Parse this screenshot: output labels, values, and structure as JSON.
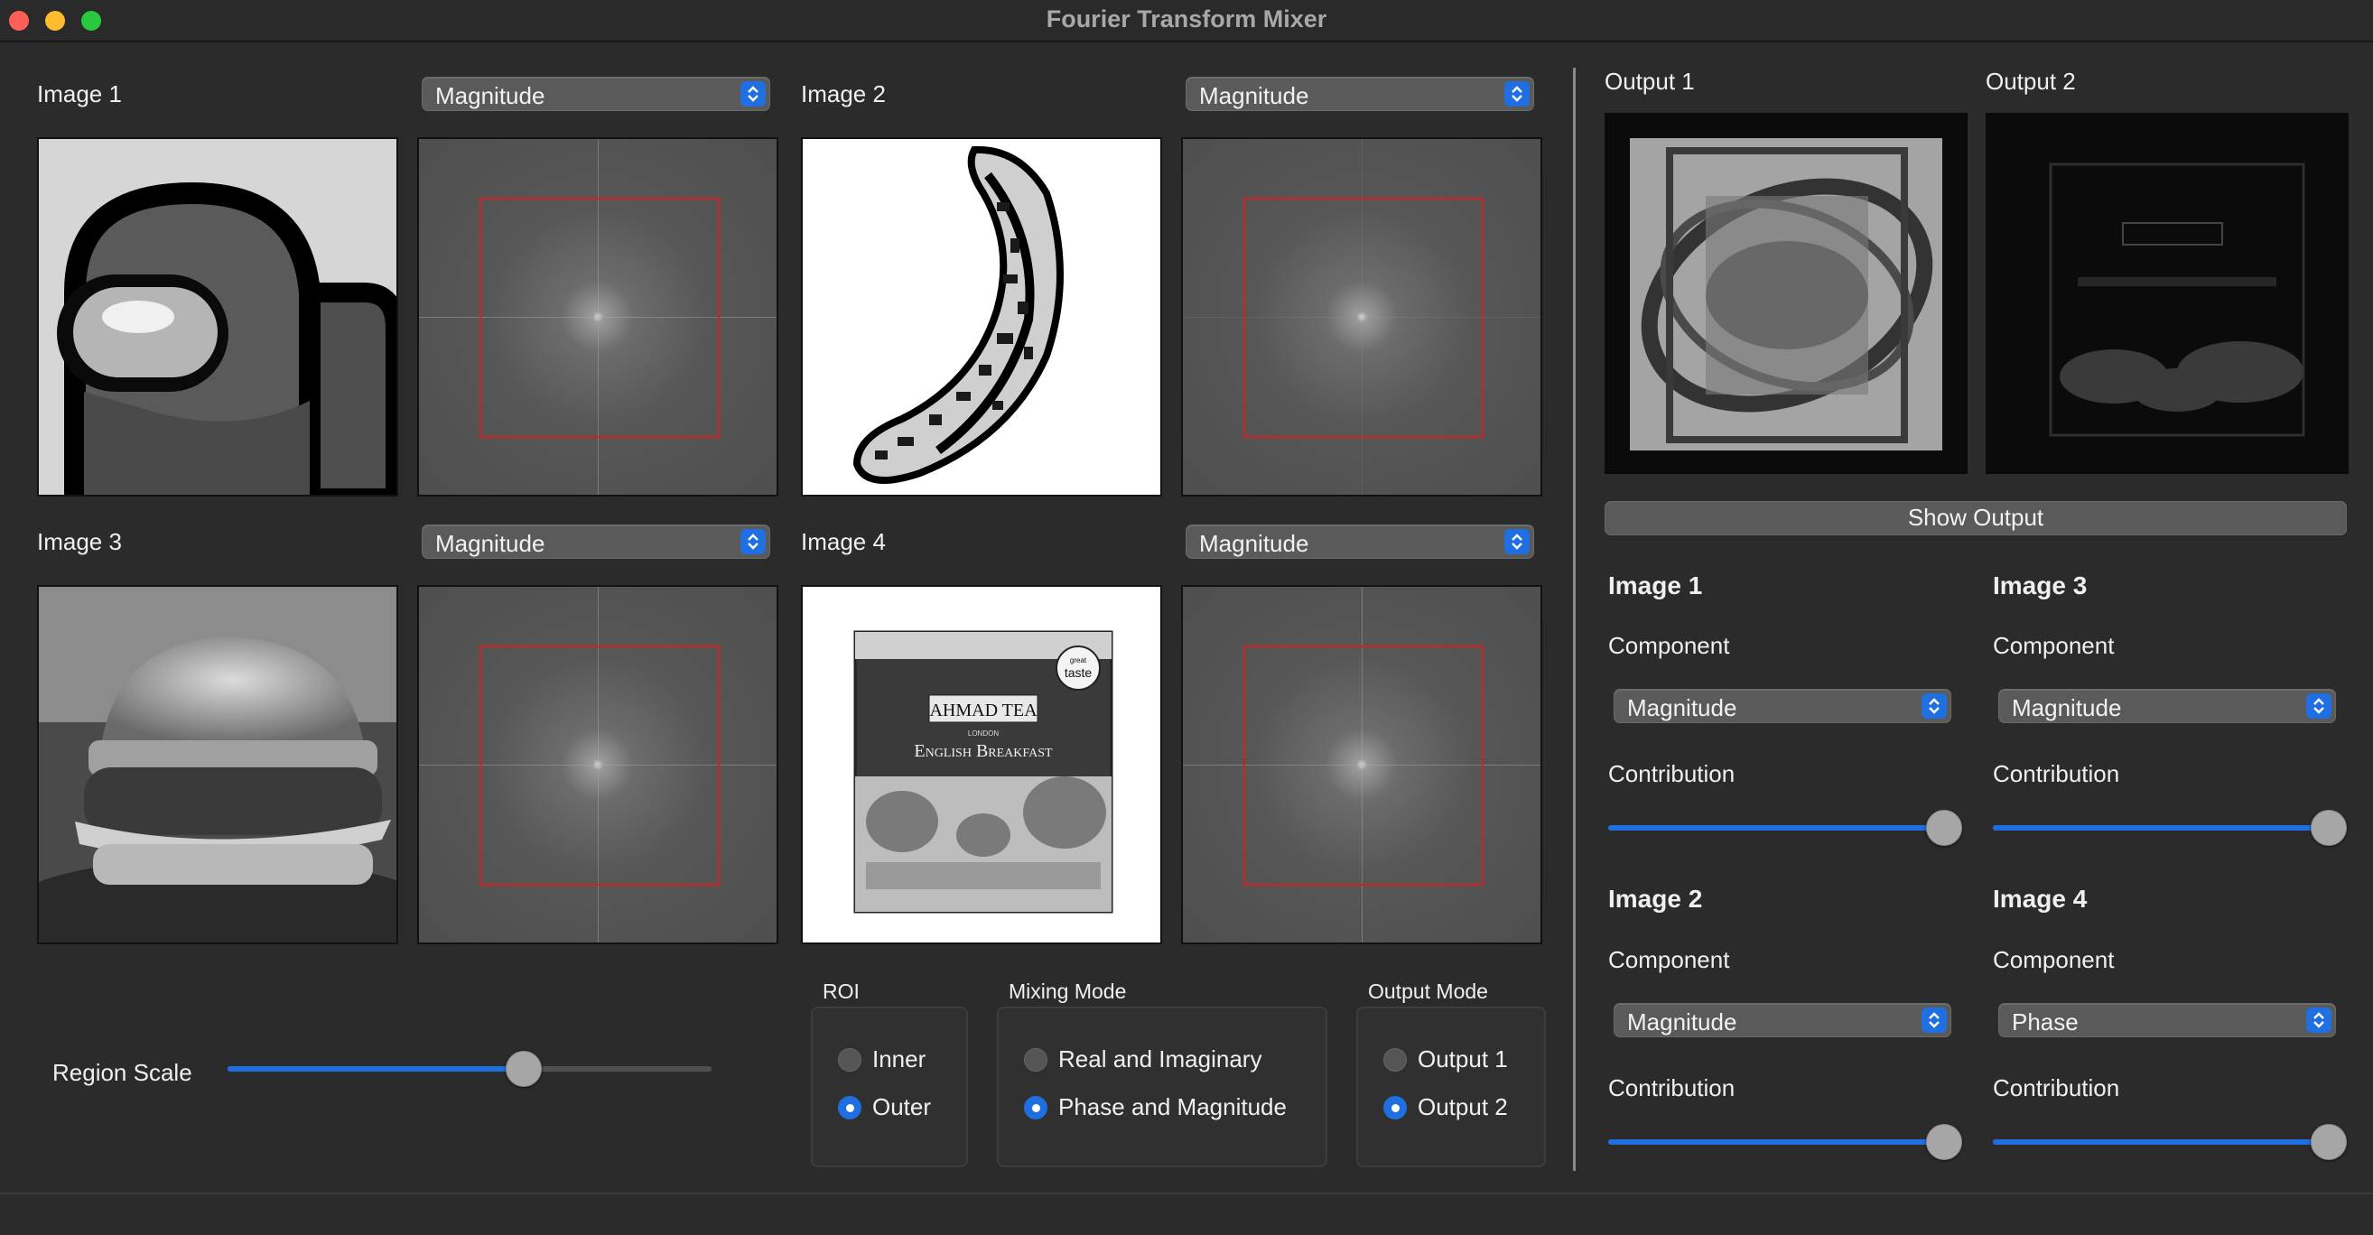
{
  "window": {
    "title": "Fourier Transform Mixer"
  },
  "inputs": [
    {
      "label": "Image 1",
      "component": "Magnitude"
    },
    {
      "label": "Image 2",
      "component": "Magnitude"
    },
    {
      "label": "Image 3",
      "component": "Magnitude"
    },
    {
      "label": "Image 4",
      "component": "Magnitude"
    }
  ],
  "tea_box": {
    "brand": "AHMAD TEA",
    "city": "LONDON",
    "product": "English Breakfast",
    "badge_top": "great",
    "badge_main": "taste"
  },
  "region": {
    "label": "Region Scale",
    "value": 0.62
  },
  "roi": {
    "title": "ROI",
    "options": [
      "Inner",
      "Outer"
    ],
    "selected": "Outer"
  },
  "mixing_mode": {
    "title": "Mixing Mode",
    "options": [
      "Real and Imaginary",
      "Phase and Magnitude"
    ],
    "selected": "Phase and Magnitude"
  },
  "output_mode": {
    "title": "Output Mode",
    "options": [
      "Output 1",
      "Output 2"
    ],
    "selected": "Output 2"
  },
  "outputs": {
    "output1_label": "Output 1",
    "output2_label": "Output 2",
    "show_button": "Show Output"
  },
  "mixer": [
    {
      "title": "Image 1",
      "component_label": "Component",
      "component": "Magnitude",
      "contribution_label": "Contribution",
      "contribution": 1.0
    },
    {
      "title": "Image 3",
      "component_label": "Component",
      "component": "Magnitude",
      "contribution_label": "Contribution",
      "contribution": 1.0
    },
    {
      "title": "Image 2",
      "component_label": "Component",
      "component": "Magnitude",
      "contribution_label": "Contribution",
      "contribution": 1.0
    },
    {
      "title": "Image 4",
      "component_label": "Component",
      "component": "Phase",
      "contribution_label": "Contribution",
      "contribution": 1.0
    }
  ],
  "colors": {
    "accent": "#1f6fe0",
    "roi_rect": "#d42020",
    "background": "#2b2b2b"
  },
  "icons": {
    "popup": "chevron-updown-icon",
    "close": "close-icon",
    "minimize": "minimize-icon",
    "zoom": "zoom-icon"
  }
}
